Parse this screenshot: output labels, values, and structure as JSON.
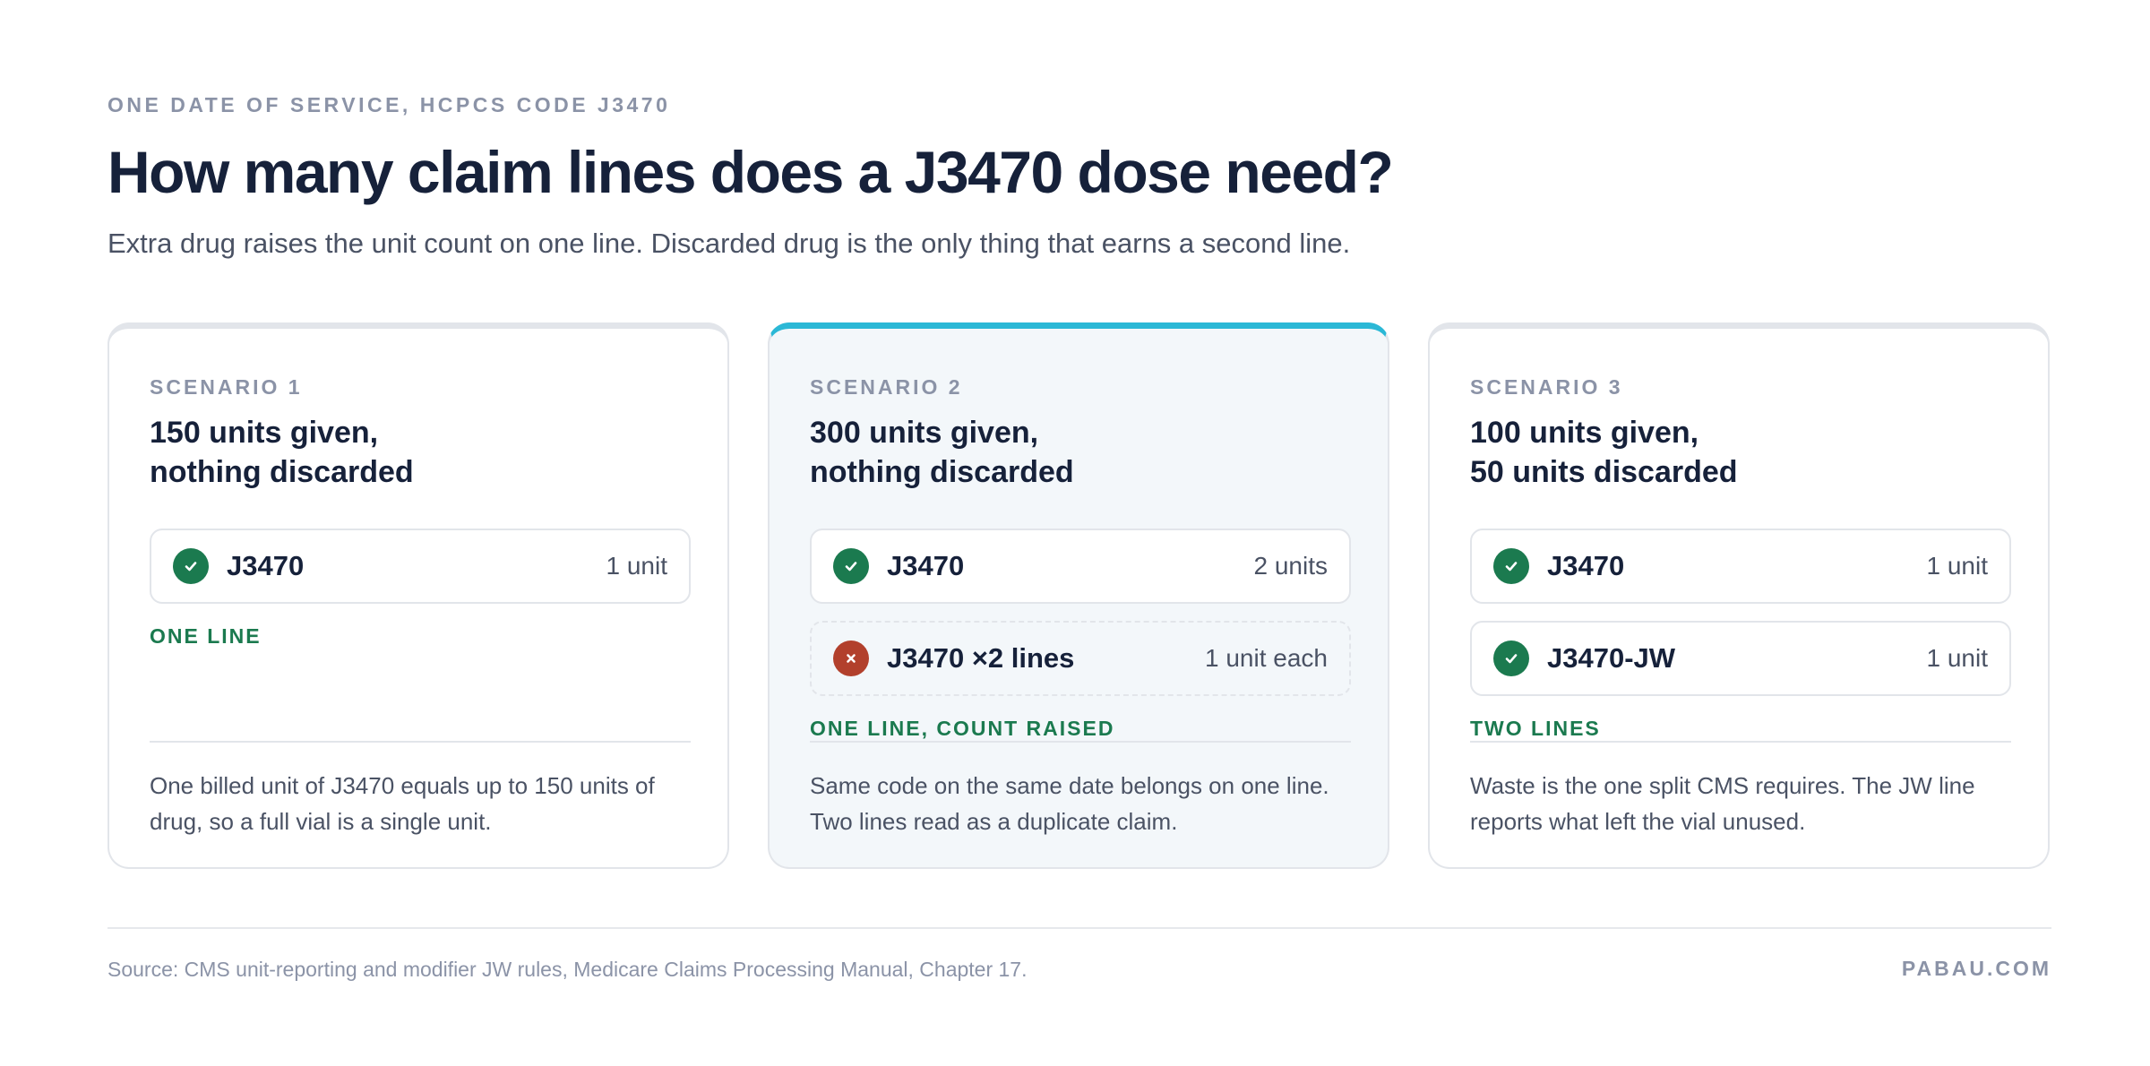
{
  "header": {
    "eyebrow": "ONE DATE OF SERVICE, HCPCS CODE J3470",
    "title": "How many claim lines does a J3470 dose need?",
    "subtitle": "Extra drug raises the unit count on one line. Discarded drug is the only thing that earns a second line."
  },
  "colors": {
    "accent_top_bar": "#2bb8d6",
    "ok_green": "#1b7a4f",
    "reject_red": "#b2402c"
  },
  "scenarios": [
    {
      "label": "SCENARIO 1",
      "heading_line1": "150 units given,",
      "heading_line2": "nothing discarded",
      "lines": [
        {
          "status": "check-icon",
          "code": "J3470",
          "units": "1 unit"
        }
      ],
      "verdict": "ONE LINE",
      "explanation": "One billed unit of J3470 equals up to 150 units of drug, so a full vial is a single unit."
    },
    {
      "label": "SCENARIO 2",
      "heading_line1": "300 units given,",
      "heading_line2": "nothing discarded",
      "lines": [
        {
          "status": "check-icon",
          "code": "J3470",
          "units": "2 units"
        },
        {
          "status": "cross-icon",
          "code": "J3470 ×2 lines",
          "units": "1 unit each"
        }
      ],
      "verdict": "ONE LINE, COUNT RAISED",
      "explanation": "Same code on the same date belongs on one line. Two lines read as a duplicate claim."
    },
    {
      "label": "SCENARIO 3",
      "heading_line1": "100 units given,",
      "heading_line2": "50 units discarded",
      "lines": [
        {
          "status": "check-icon",
          "code": "J3470",
          "units": "1 unit"
        },
        {
          "status": "check-icon",
          "code": "J3470-JW",
          "units": "1 unit"
        }
      ],
      "verdict": "TWO LINES",
      "explanation": "Waste is the one split CMS requires. The JW line reports what left the vial unused."
    }
  ],
  "footer": {
    "source": "Source: CMS unit-reporting and modifier JW rules, Medicare Claims Processing Manual, Chapter 17.",
    "brand": "PABAU.COM"
  }
}
